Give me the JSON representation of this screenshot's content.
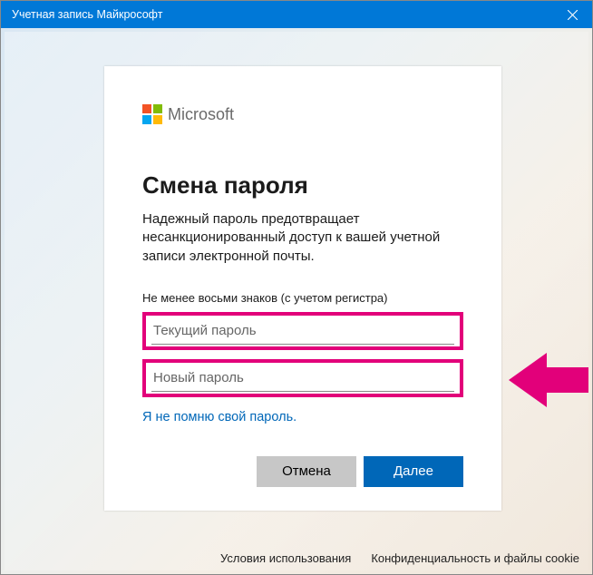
{
  "titlebar": {
    "title": "Учетная запись Майкрософт"
  },
  "brand": {
    "text": "Microsoft"
  },
  "heading": "Смена пароля",
  "subtext": "Надежный пароль предотвращает несанкционированный доступ к вашей учетной записи электронной почты.",
  "hint": "Не менее восьми знаков (с учетом регистра)",
  "fields": {
    "current": {
      "placeholder": "Текущий пароль",
      "value": ""
    },
    "new": {
      "placeholder": "Новый пароль",
      "value": ""
    }
  },
  "forgot": "Я не помню свой пароль.",
  "buttons": {
    "cancel": "Отмена",
    "next": "Далее"
  },
  "footer": {
    "terms": "Условия использования",
    "privacy": "Конфиденциальность и файлы cookie"
  }
}
